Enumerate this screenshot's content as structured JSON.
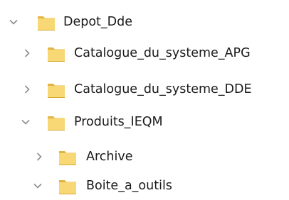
{
  "tree": {
    "icons": {
      "expanded": "chevron-down-icon",
      "collapsed": "chevron-right-icon",
      "folder": "folder-icon"
    },
    "colors": {
      "folder_body": "#f8d775",
      "folder_tab": "#e2b441",
      "folder_edge": "#d6a92f",
      "chevron": "#8c8c8c",
      "text": "#1a1a1a"
    },
    "items": [
      {
        "label": "Depot_Dde",
        "state": "expanded"
      },
      {
        "label": "Catalogue_du_systeme_APG",
        "state": "collapsed"
      },
      {
        "label": "Catalogue_du_systeme_DDE",
        "state": "collapsed"
      },
      {
        "label": "Produits_IEQM",
        "state": "expanded"
      },
      {
        "label": "Archive",
        "state": "collapsed"
      },
      {
        "label": "Boite_a_outils",
        "state": "expanded"
      }
    ]
  }
}
